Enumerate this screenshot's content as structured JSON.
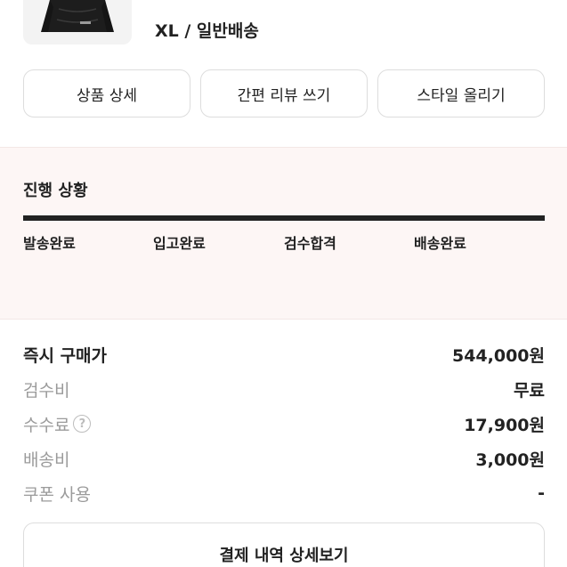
{
  "product": {
    "image_icon": "black-padded-jacket",
    "option": "XL / 일반배송"
  },
  "actions": {
    "product_detail": "상품 상세",
    "quick_review": "간편 리뷰 쓰기",
    "upload_style": "스타일 올리기"
  },
  "progress": {
    "title": "진행 상황",
    "steps": [
      "발송완료",
      "입고완료",
      "검수합격",
      "배송완료"
    ],
    "completion": 1.0
  },
  "price": {
    "instant_buy": {
      "label": "즉시 구매가",
      "value": "544,000원"
    },
    "inspection": {
      "label": "검수비",
      "value": "무료"
    },
    "fee": {
      "label": "수수료",
      "value": "17,900원",
      "help_icon": "question-circle-icon"
    },
    "shipping": {
      "label": "배송비",
      "value": "3,000원"
    },
    "coupon": {
      "label": "쿠폰 사용",
      "value": "-"
    }
  },
  "payment_detail_button": "결제 내역 상세보기"
}
